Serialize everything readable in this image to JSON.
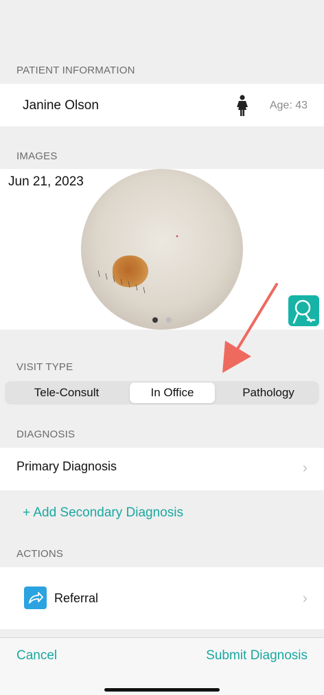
{
  "patient_section": {
    "header": "PATIENT INFORMATION",
    "name": "Janine Olson",
    "gender_icon": "female-person-icon",
    "age": "Age: 43"
  },
  "images_section": {
    "header": "IMAGES",
    "date": "Jun 21, 2023",
    "page_dots": {
      "count": 2,
      "active_index": 0
    },
    "tool_icon": "dermatoscope-icon"
  },
  "visit_type": {
    "header": "VISIT TYPE",
    "options": [
      "Tele-Consult",
      "In Office",
      "Pathology"
    ],
    "selected": "In Office"
  },
  "diagnosis": {
    "header": "DIAGNOSIS",
    "primary_label": "Primary Diagnosis",
    "add_secondary": "+ Add Secondary Diagnosis"
  },
  "actions": {
    "header": "ACTIONS",
    "referral_label": "Referral",
    "referral_icon": "share-arrow-icon"
  },
  "bottom_bar": {
    "cancel": "Cancel",
    "submit": "Submit Diagnosis"
  },
  "colors": {
    "accent": "#1aa7a0",
    "annotation_arrow": "#ee6a5f",
    "referral_icon_bg": "#2ba3e0",
    "derm_icon_bg": "#17b3a6"
  }
}
